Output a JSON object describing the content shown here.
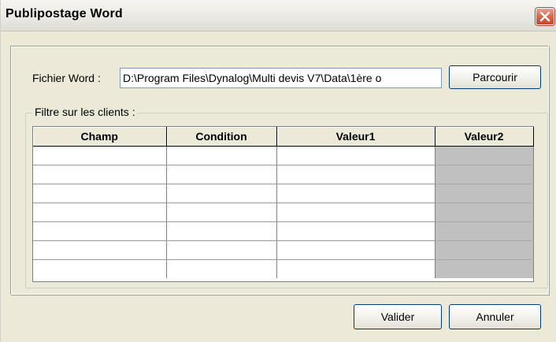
{
  "window": {
    "title": "Publipostage Word",
    "close_icon": "close-icon"
  },
  "file": {
    "label": "Fichier Word :",
    "value": "D:\\Program Files\\Dynalog\\Multi devis V7\\Data\\1ère o",
    "browse_label": "Parcourir"
  },
  "filter": {
    "legend": "Filtre sur les clients :",
    "columns": [
      "Champ",
      "Condition",
      "Valeur1",
      "Valeur2"
    ],
    "row_count": 7
  },
  "actions": {
    "ok_label": "Valider",
    "cancel_label": "Annuler"
  },
  "colors": {
    "face": "#ece9d8",
    "close_button": "#d86a4c",
    "disabled_column": "#c0c0c0"
  }
}
